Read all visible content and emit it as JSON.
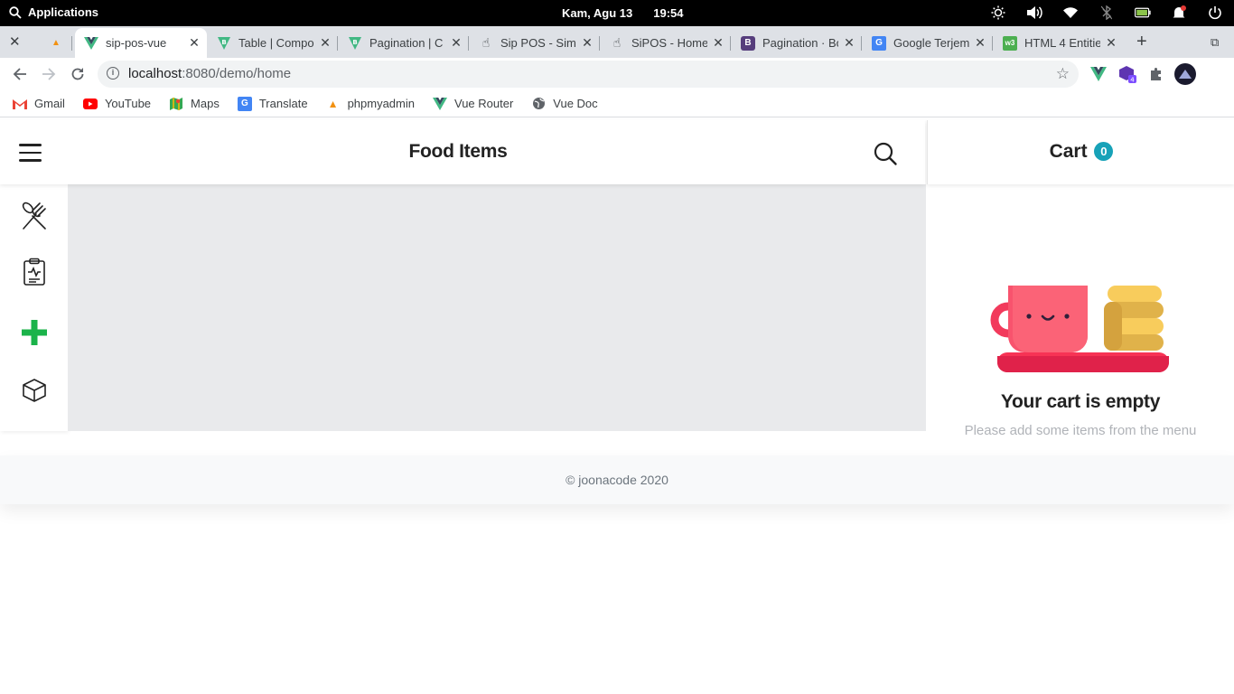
{
  "system": {
    "activities_label": "Applications",
    "date": "Kam, Agu 13",
    "time": "19:54",
    "tray_icons": [
      "brightness-icon",
      "volume-icon",
      "wifi-icon",
      "bluetooth-icon",
      "battery-icon",
      "notification-icon",
      "power-icon"
    ]
  },
  "browser": {
    "tabs": [
      {
        "title": "",
        "favicon": "pma-icon",
        "color": "#f29111"
      },
      {
        "title": "sip-pos-vue",
        "favicon": "vue-icon",
        "color": "#41b883",
        "active": true
      },
      {
        "title": "Table | Compo",
        "favicon": "bootstrap-vue-icon",
        "color": "#563d7c"
      },
      {
        "title": "Pagination | C",
        "favicon": "bootstrap-vue-icon",
        "color": "#563d7c"
      },
      {
        "title": "Sip POS - Simp",
        "favicon": "hand-icon",
        "color": "#3c4043"
      },
      {
        "title": "SiPOS - Home",
        "favicon": "hand-icon",
        "color": "#3c4043"
      },
      {
        "title": "Pagination · Bo",
        "favicon": "bootstrap-icon",
        "color": "#563d7c"
      },
      {
        "title": "Google Terjem",
        "favicon": "translate-icon",
        "color": "#4285f4"
      },
      {
        "title": "HTML 4 Entitie",
        "favicon": "w3-icon",
        "color": "#4caf50"
      }
    ],
    "url_host": "localhost",
    "url_path": ":8080/demo/home",
    "extension_badge": "4",
    "bookmarks": [
      {
        "label": "Gmail",
        "icon": "gmail-icon",
        "color": "#ea4335"
      },
      {
        "label": "YouTube",
        "icon": "youtube-icon",
        "color": "#ff0000"
      },
      {
        "label": "Maps",
        "icon": "maps-icon",
        "color": "#34a853"
      },
      {
        "label": "Translate",
        "icon": "translate-icon",
        "color": "#4285f4"
      },
      {
        "label": "phpmyadmin",
        "icon": "pma-icon",
        "color": "#f29111"
      },
      {
        "label": "Vue Router",
        "icon": "vue-icon",
        "color": "#41b883"
      },
      {
        "label": "Vue Doc",
        "icon": "globe-icon",
        "color": "#5f6368"
      }
    ]
  },
  "app": {
    "page_title": "Food Items",
    "cart_label": "Cart",
    "cart_count": "0",
    "cart_empty_title": "Your cart is empty",
    "cart_empty_subtitle": "Please add some items from the menu",
    "footer_text": "© joonacode 2020",
    "sidebar_items": [
      "food-icon",
      "order-history-icon",
      "add-item-icon",
      "product-box-icon"
    ],
    "accent_color": "#17a2b8",
    "add_color": "#1bb34a"
  }
}
